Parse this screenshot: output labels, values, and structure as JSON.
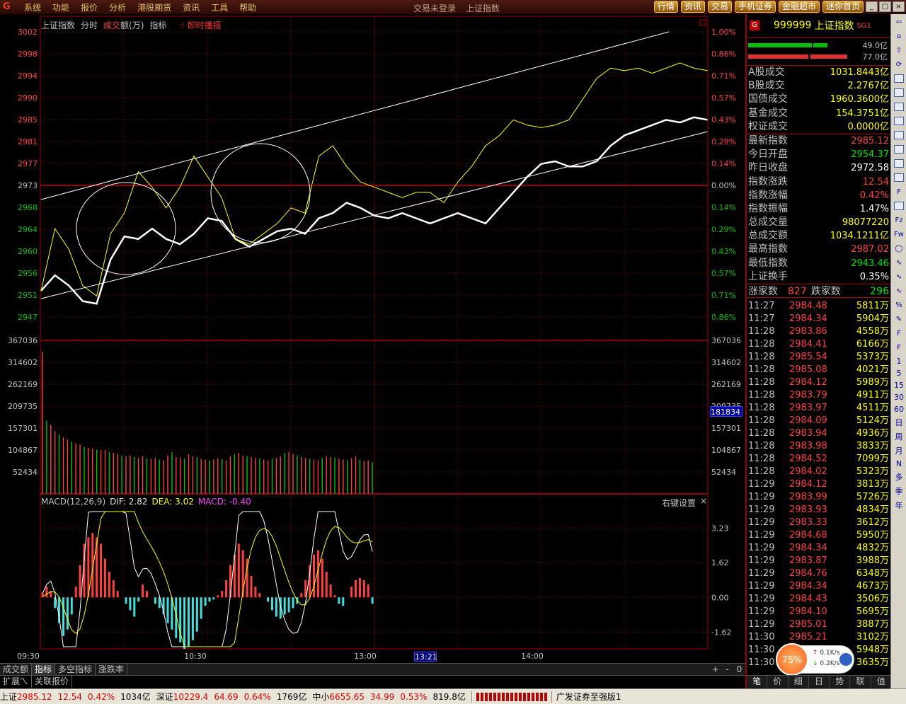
{
  "menubar": {
    "items": [
      "系统",
      "功能",
      "报价",
      "分析",
      "港股期货",
      "资讯",
      "工具",
      "帮助"
    ],
    "title_left": "交易未登录",
    "title_right": "上证指数",
    "buttons": [
      "行情",
      "资讯",
      "交易",
      "手机证券",
      "金融超市",
      "迷你首页"
    ]
  },
  "chart_header": {
    "title": "上证指数",
    "tab_fenshi": "分时",
    "tab_volume_red": "成交",
    "tab_volume_rest": "额(万)",
    "tab_indicator": "指标",
    "broadcast": "即时播报"
  },
  "macd_header": {
    "name": "MACD(12,26,9)",
    "dif": "DIF: 2.82",
    "dea": "DEA: 3.02",
    "macd": "MACD: -0.40",
    "settings": "右键设置",
    "close": "×"
  },
  "cursor_tag": "181834",
  "time_cursor_tag": "13:21",
  "chart_data": [
    {
      "type": "line",
      "title": "上证指数",
      "yticks_left": [
        "3002",
        "2998",
        "2994",
        "2990",
        "2985",
        "2981",
        "2977",
        "2973",
        "2968",
        "2964",
        "2960",
        "2956",
        "2951",
        "2947"
      ],
      "yticks_right": [
        "1.00%",
        "0.86%",
        "0.71%",
        "0.57%",
        "0.43%",
        "0.29%",
        "0.14%",
        "0.00%",
        "0.14%",
        "0.29%",
        "0.43%",
        "0.57%",
        "0.71%",
        "0.86%"
      ],
      "ylim": [
        2945.3,
        3002
      ],
      "prev_close": 2972.58,
      "x_labels": [
        "09:30",
        "10:30",
        "13:00",
        "14:00"
      ],
      "series": [
        {
          "color": "#ffffff",
          "x": [
            0,
            5,
            10,
            15,
            20,
            25,
            30,
            35,
            40,
            45,
            50,
            55,
            60,
            65,
            70,
            75,
            80,
            85,
            90,
            95,
            100,
            105,
            110,
            115,
            120,
            125,
            130,
            135,
            140,
            145,
            150,
            155,
            160,
            165,
            170,
            175,
            180,
            185,
            190,
            195,
            200,
            205,
            210,
            215,
            220,
            225,
            230,
            235,
            240
          ],
          "y": [
            2952,
            2955,
            2953,
            2950,
            2949.5,
            2958,
            2962.5,
            2962,
            2964,
            2962,
            2961,
            2963,
            2966,
            2965.5,
            2962,
            2960.5,
            2962,
            2963.5,
            2964,
            2963,
            2966,
            2967,
            2969,
            2968,
            2966.5,
            2966,
            2967,
            2966,
            2965,
            2966,
            2967,
            2966,
            2965,
            2968,
            2971,
            2974,
            2976.5,
            2977,
            2976,
            2976,
            2977,
            2980,
            2982,
            2983,
            2984,
            2985,
            2984.5,
            2985.5,
            2985
          ]
        },
        {
          "color": "#ffff00",
          "x": [
            0,
            5,
            10,
            15,
            20,
            25,
            30,
            35,
            40,
            45,
            50,
            55,
            60,
            65,
            70,
            75,
            80,
            85,
            90,
            95,
            100,
            105,
            110,
            115,
            120,
            125,
            130,
            135,
            140,
            145,
            150,
            155,
            160,
            165,
            170,
            175,
            180,
            185,
            190,
            195,
            200,
            205,
            210,
            215,
            220,
            225,
            230,
            235,
            240
          ],
          "y": [
            2952,
            2964,
            2960,
            2953,
            2951,
            2963,
            2967,
            2975,
            2972,
            2968,
            2972,
            2978,
            2974,
            2970,
            2962,
            2961,
            2963,
            2965,
            2968,
            2967,
            2978,
            2980,
            2976,
            2973,
            2972,
            2971,
            2970,
            2971,
            2971,
            2969,
            2973,
            2976,
            2980,
            2982,
            2985,
            2984,
            2983.5,
            2984,
            2985,
            2989,
            2993,
            2995,
            2994.5,
            2995,
            2994,
            2995,
            2996,
            2995,
            2994.5
          ]
        }
      ]
    },
    {
      "type": "bar",
      "title": "成交额(万)",
      "yticks": [
        "367036",
        "314602",
        "262169",
        "209735",
        "157301",
        "104867",
        "52434"
      ],
      "ylim": [
        0,
        367036
      ],
      "values": [
        340000,
        175000,
        165000,
        150000,
        142000,
        135000,
        130000,
        125000,
        120000,
        118000,
        112000,
        110000,
        108000,
        106000,
        104000,
        105000,
        100000,
        98000,
        95000,
        92000,
        90000,
        92000,
        88000,
        86000,
        90000,
        85000,
        84000,
        86000,
        82000,
        80000,
        92000,
        100000,
        88000,
        86000,
        84000,
        95000,
        90000,
        88000,
        84000,
        82000,
        80000,
        82000,
        85000,
        83000,
        80000,
        90000,
        95000,
        98000,
        92000,
        90000,
        88000,
        86000,
        84000,
        82000,
        80000,
        84000,
        86000,
        90000,
        98000,
        100000,
        95000,
        92000,
        88000,
        86000,
        84000,
        82000,
        80000,
        86000,
        90000,
        88000,
        86000,
        84000,
        82000,
        80000,
        85000,
        90000,
        82000,
        78000,
        80000,
        75000
      ]
    },
    {
      "type": "bar",
      "title": "MACD(12,26,9)",
      "yticks": [
        "3.23",
        "1.62",
        "0.00",
        "-1.62"
      ],
      "ylim": [
        -2.4,
        4.1
      ],
      "values": [
        0.2,
        0.5,
        0.3,
        -0.5,
        -1.2,
        -1.8,
        -1.5,
        -0.8,
        0.5,
        1.5,
        2.5,
        2.8,
        3.0,
        2.8,
        2.5,
        1.8,
        1.2,
        0.8,
        0.3,
        0,
        -0.3,
        -0.6,
        -0.9,
        -0.2,
        0.6,
        0.3,
        0,
        -0.3,
        -0.5,
        -0.8,
        -1.2,
        -1.5,
        -1.9,
        -2.1,
        -2.4,
        -2.3,
        -2.0,
        -1.6,
        -1.0,
        -0.4,
        -0.2,
        -0.1,
        0.1,
        0.3,
        0.8,
        1.5,
        2.0,
        2.5,
        2.2,
        1.8,
        1.0,
        0.5,
        0.2,
        0,
        -0.2,
        -0.6,
        -0.9,
        -1.0,
        -0.8,
        -0.7,
        -0.5,
        -0.3,
        0.2,
        0.8,
        1.5,
        2.0,
        2.2,
        1.8,
        1.2,
        0.6,
        0.1,
        -0.3,
        -0.4,
        0,
        0.5,
        0.8,
        0.9,
        0.8,
        0.6,
        -0.3
      ]
    }
  ],
  "bottom_tabs": [
    "成交额",
    "指标",
    "多空指标",
    "涨跌率"
  ],
  "bottom_ctrls": [
    "+",
    "-",
    "0"
  ],
  "ext_bar": [
    "扩展ㄟ",
    "关联报价"
  ],
  "right_panel": {
    "badge": "G",
    "code": "999999",
    "name": "上证指数",
    "sg": "SG1",
    "bar_top_label": "49.0亿",
    "bar_bottom_label": "77.0亿",
    "group1": [
      {
        "label": "A股成交",
        "value": "1031.8443亿",
        "color": "c-yellow"
      },
      {
        "label": "B股成交",
        "value": "2.2767亿",
        "color": "c-yellow"
      },
      {
        "label": "国债成交",
        "value": "1960.3600亿",
        "color": "c-yellow"
      },
      {
        "label": "基金成交",
        "value": "154.3751亿",
        "color": "c-yellow"
      },
      {
        "label": "权证成交",
        "value": "0.0000亿",
        "color": "c-yellow"
      }
    ],
    "group2": [
      {
        "label": "最新指数",
        "value": "2985.12",
        "color": "c-red"
      },
      {
        "label": "今日开盘",
        "value": "2954.37",
        "color": "c-green"
      },
      {
        "label": "昨日收盘",
        "value": "2972.58",
        "color": "c-white"
      },
      {
        "label": "指数涨跌",
        "value": "12.54",
        "color": "c-red"
      },
      {
        "label": "指数涨幅",
        "value": "0.42%",
        "color": "c-red"
      },
      {
        "label": "指数振幅",
        "value": "1.47%",
        "color": "c-white"
      },
      {
        "label": "总成交量",
        "value": "98077220",
        "color": "c-yellow"
      },
      {
        "label": "总成交额",
        "value": "1034.1211亿",
        "color": "c-yellow"
      },
      {
        "label": "最高指数",
        "value": "2987.02",
        "color": "c-red"
      },
      {
        "label": "最低指数",
        "value": "2943.46",
        "color": "c-green"
      },
      {
        "label": "上证换手",
        "value": "0.35%",
        "color": "c-white"
      }
    ],
    "adv_label": "涨家数",
    "adv_value": "827",
    "dec_label": "跌家数",
    "dec_value": "296",
    "ticks": [
      [
        "11:27",
        "2984.48",
        "5811万"
      ],
      [
        "11:27",
        "2984.34",
        "5904万"
      ],
      [
        "11:28",
        "2983.86",
        "4558万"
      ],
      [
        "11:28",
        "2984.41",
        "6166万"
      ],
      [
        "11:28",
        "2985.54",
        "5373万"
      ],
      [
        "11:28",
        "2985.08",
        "4021万"
      ],
      [
        "11:28",
        "2984.12",
        "5989万"
      ],
      [
        "11:28",
        "2983.79",
        "4911万"
      ],
      [
        "11:28",
        "2983.97",
        "4511万"
      ],
      [
        "11:28",
        "2984.09",
        "5124万"
      ],
      [
        "11:28",
        "2983.94",
        "4936万"
      ],
      [
        "11:28",
        "2983.98",
        "3833万"
      ],
      [
        "11:28",
        "2984.52",
        "7099万"
      ],
      [
        "11:28",
        "2984.02",
        "5323万"
      ],
      [
        "11:29",
        "2984.12",
        "3813万"
      ],
      [
        "11:29",
        "2983.99",
        "5726万"
      ],
      [
        "11:29",
        "2983.93",
        "4834万"
      ],
      [
        "11:29",
        "2983.33",
        "3612万"
      ],
      [
        "11:29",
        "2984.68",
        "5950万"
      ],
      [
        "11:29",
        "2984.34",
        "4832万"
      ],
      [
        "11:29",
        "2983.87",
        "3988万"
      ],
      [
        "11:29",
        "2984.76",
        "6348万"
      ],
      [
        "11:29",
        "2984.34",
        "4673万"
      ],
      [
        "11:29",
        "2984.43",
        "3506万"
      ],
      [
        "11:29",
        "2984.10",
        "5695万"
      ],
      [
        "11:29",
        "2985.01",
        "3887万"
      ],
      [
        "11:30",
        "2985.21",
        "3102万"
      ],
      [
        "11:30",
        "2985.21",
        "5948万"
      ],
      [
        "11:30",
        "2985.21",
        "3635万"
      ]
    ],
    "speed_pct": "75%",
    "speed_up": "0.1K/s",
    "speed_down": "0.2K/s",
    "tabs": [
      "笔",
      "价",
      "细",
      "日",
      "势",
      "联",
      "值"
    ]
  },
  "side_toolbar": {
    "periods": [
      "1",
      "5",
      "15",
      "30",
      "60",
      "日",
      "周",
      "月",
      "N",
      "多",
      "季",
      "年"
    ]
  },
  "statusbar": {
    "sh_label": "上证",
    "sh_value": "2985.12",
    "sh_change": "12.54",
    "sh_pct": "0.42%",
    "sh_amount": "1034亿",
    "sz_label": "深证",
    "sz_value": "10229.4",
    "sz_change": "64.69",
    "sz_pct": "0.64%",
    "sz_amount": "1769亿",
    "zx_label": "中小",
    "zx_value": "6655.65",
    "zx_change": "34.99",
    "zx_pct": "0.53%",
    "zx_amount": "819.8亿",
    "broker": "广发证券至强版1"
  }
}
